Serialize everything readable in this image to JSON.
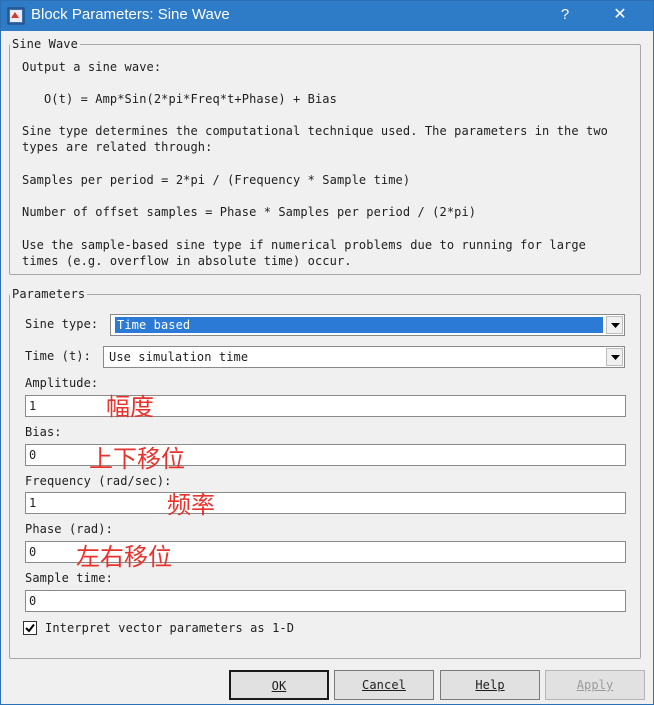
{
  "window": {
    "title": "Block Parameters: Sine Wave",
    "help_glyph": "?",
    "close_glyph": "✕",
    "icon": "simulink-block-icon"
  },
  "description": {
    "group_title": "Sine Wave",
    "lines": [
      "Output a sine wave:",
      "   O(t) = Amp*Sin(2*pi*Freq*t+Phase) + Bias",
      "Sine type determines the computational technique used. The parameters in the two",
      "types are related through:",
      "Samples per period = 2*pi / (Frequency * Sample time)",
      "Number of offset samples = Phase * Samples per period / (2*pi)",
      "Use the sample-based sine type if numerical problems due to running for large",
      "times (e.g. overflow in absolute time) occur."
    ]
  },
  "parameters": {
    "group_title": "Parameters",
    "sine_type": {
      "label": "Sine type:",
      "value": "Time based"
    },
    "time": {
      "label": "Time (t):",
      "value": "Use simulation time"
    },
    "amplitude": {
      "label": "Amplitude:",
      "value": "1",
      "annotation": "幅度"
    },
    "bias": {
      "label": "Bias:",
      "value": "0",
      "annotation": "上下移位"
    },
    "frequency": {
      "label": "Frequency (rad/sec):",
      "value": "1",
      "annotation": "频率"
    },
    "phase": {
      "label": "Phase (rad):",
      "value": "0",
      "annotation": "左右移位"
    },
    "sample_time": {
      "label": "Sample time:",
      "value": "0"
    },
    "interpret_vector": {
      "label": "Interpret vector parameters as 1-D",
      "checked": true
    }
  },
  "buttons": {
    "ok": "OK",
    "cancel": "Cancel",
    "help": "Help",
    "apply": "Apply"
  },
  "colors": {
    "titlebar": "#2e7cc7",
    "selection": "#2b7bd6",
    "annotation": "#e8322b"
  }
}
